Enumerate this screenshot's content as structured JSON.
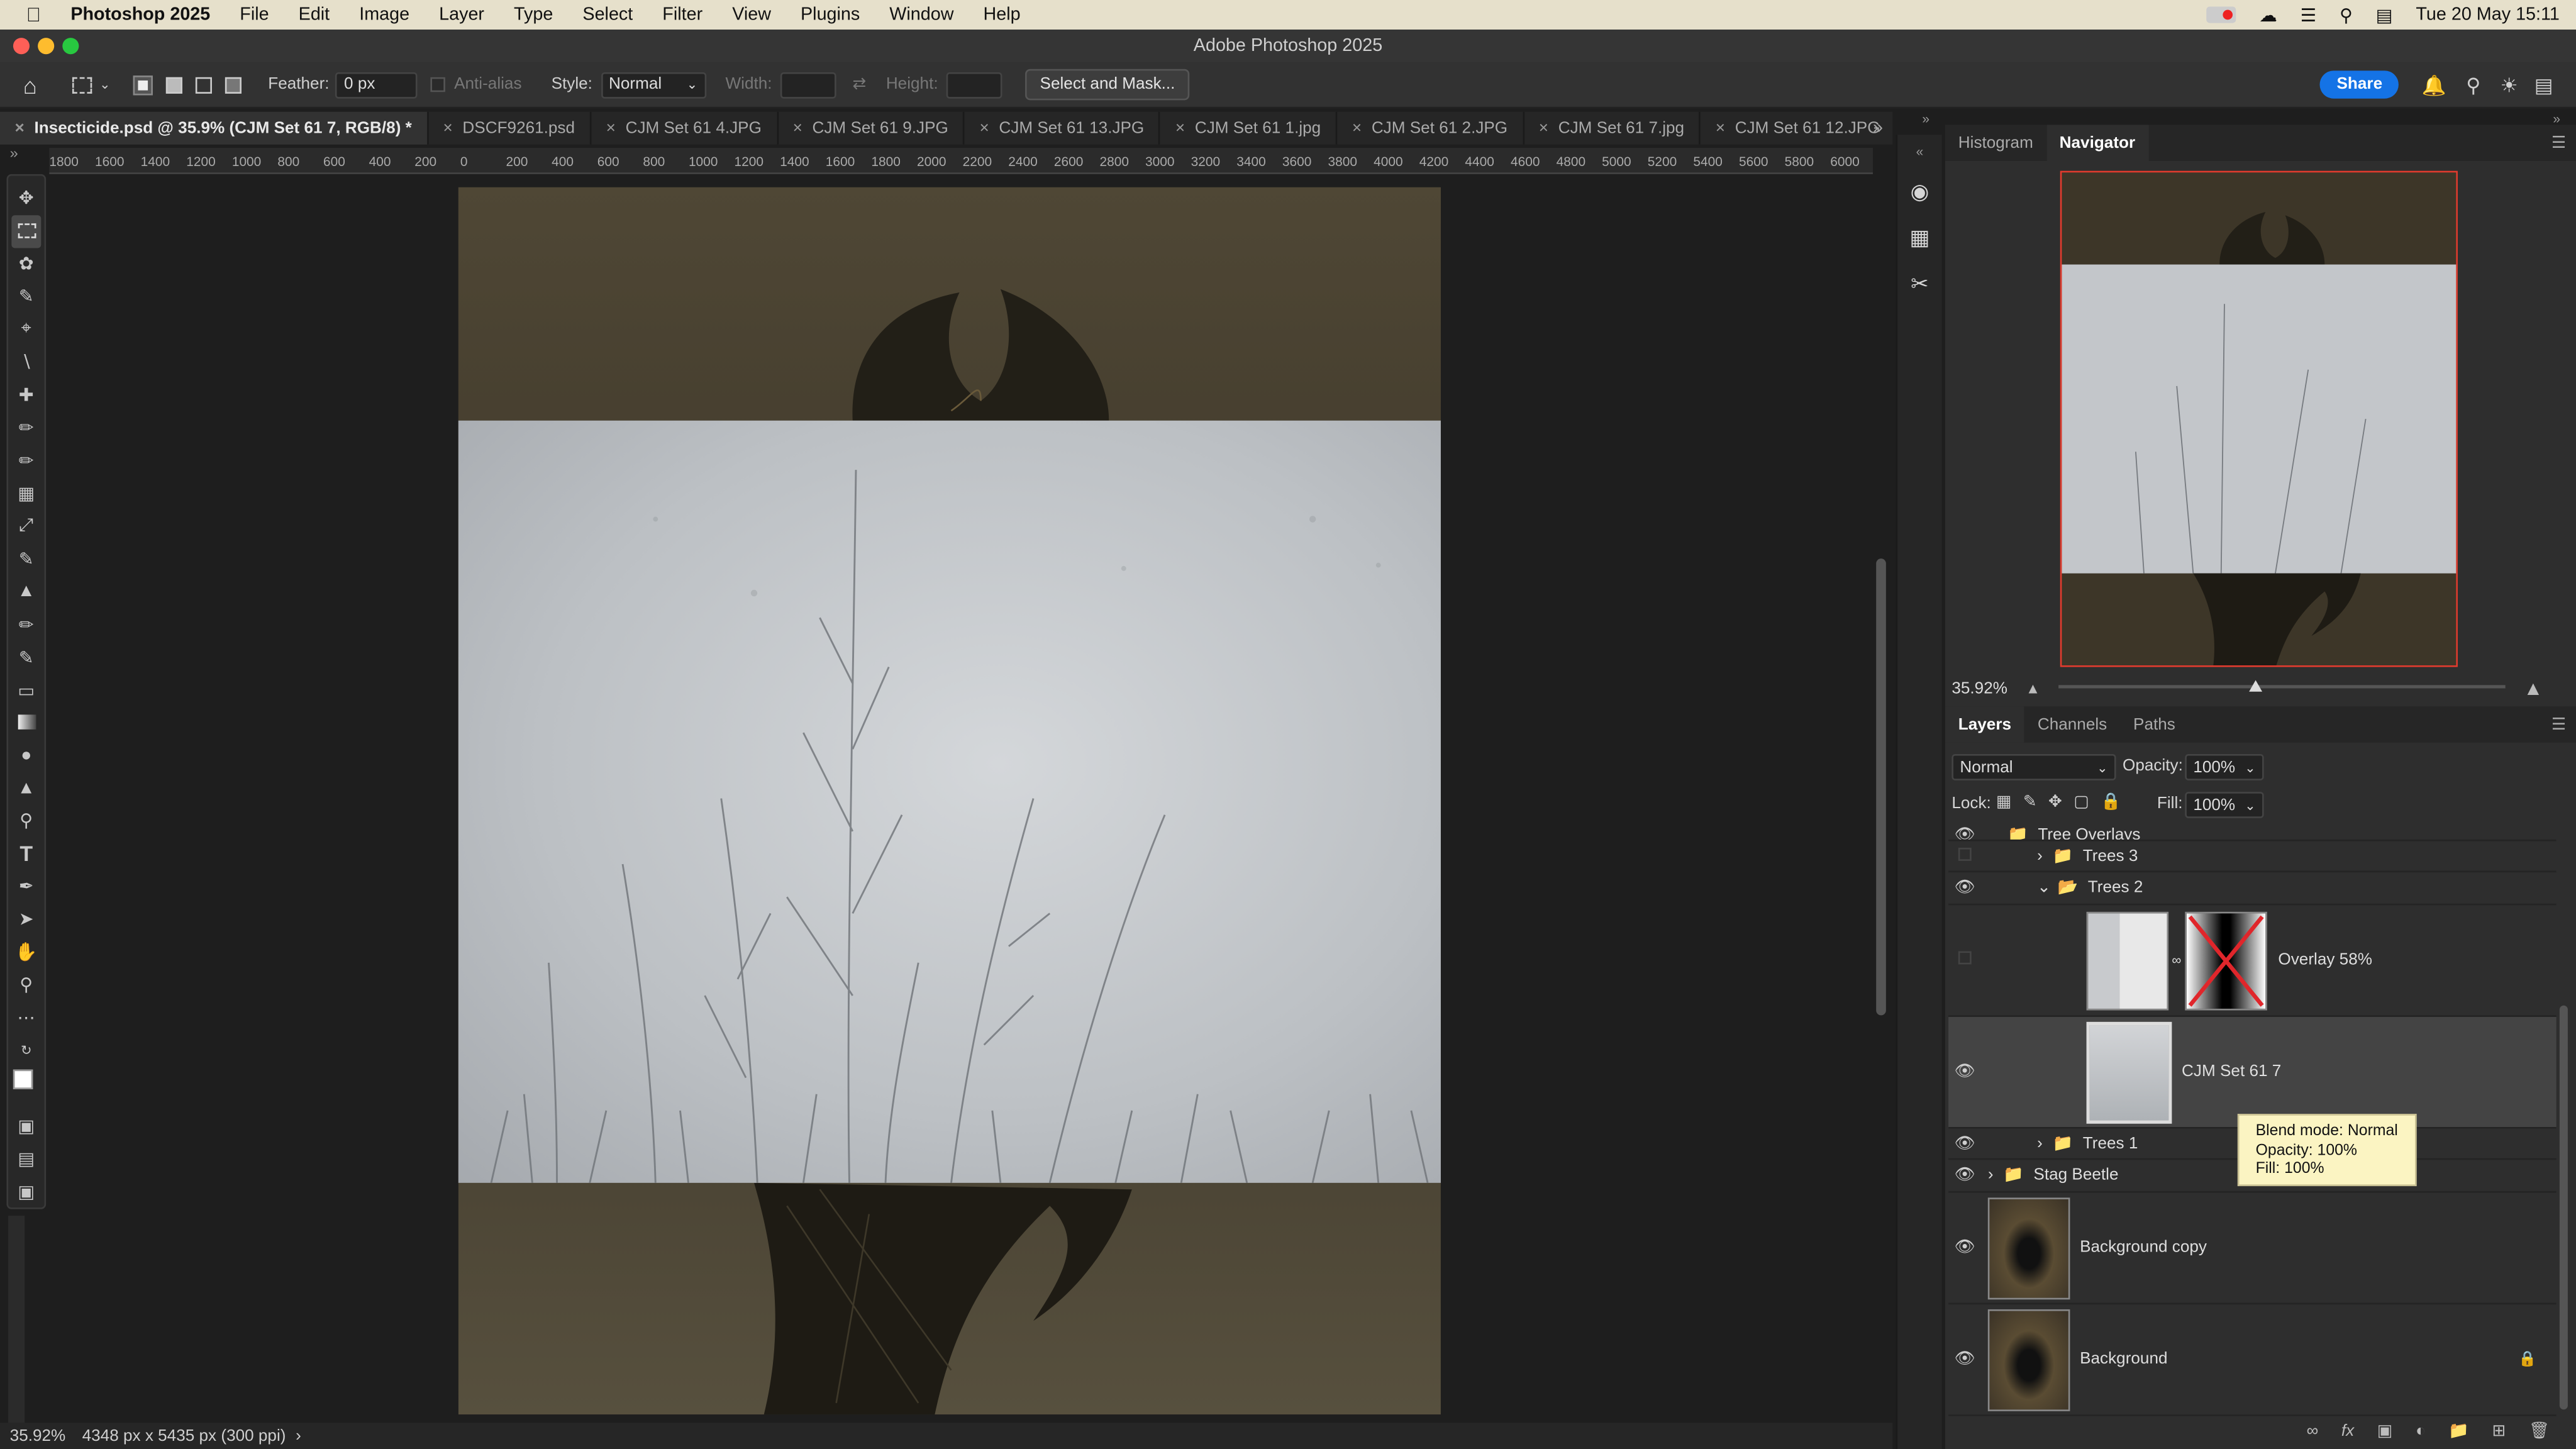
{
  "menubar": {
    "app": "Photoshop 2025",
    "items": [
      "File",
      "Edit",
      "Image",
      "Layer",
      "Type",
      "Select",
      "Filter",
      "View",
      "Plugins",
      "Window",
      "Help"
    ],
    "datetime": "Tue 20 May  15:11"
  },
  "titlebar": {
    "title": "Adobe Photoshop 2025"
  },
  "options": {
    "feather_label": "Feather:",
    "feather_value": "0 px",
    "antialias_label": "Anti-alias",
    "style_label": "Style:",
    "style_value": "Normal",
    "width_label": "Width:",
    "height_label": "Height:",
    "select_mask": "Select and Mask...",
    "share": "Share"
  },
  "tabs": [
    {
      "label": "Insecticide.psd @ 35.9% (CJM Set 61 7, RGB/8) *"
    },
    {
      "label": "DSCF9261.psd"
    },
    {
      "label": "CJM Set 61 4.JPG"
    },
    {
      "label": "CJM Set 61 9.JPG"
    },
    {
      "label": "CJM Set 61 13.JPG"
    },
    {
      "label": "CJM Set 61 1.jpg"
    },
    {
      "label": "CJM Set 61 2.JPG"
    },
    {
      "label": "CJM Set 61 7.jpg"
    },
    {
      "label": "CJM Set 61 12.JPG"
    }
  ],
  "ruler": [
    "1800",
    "1600",
    "1400",
    "1200",
    "1000",
    "800",
    "600",
    "400",
    "200",
    "0",
    "200",
    "400",
    "600",
    "800",
    "1000",
    "1200",
    "1400",
    "1600",
    "1800",
    "2000",
    "2200",
    "2400",
    "2600",
    "2800",
    "3000",
    "3200",
    "3400",
    "3600",
    "3800",
    "4000",
    "4200",
    "4400",
    "4600",
    "4800",
    "5000",
    "5200",
    "5400",
    "5600",
    "5800",
    "6000"
  ],
  "status": {
    "zoom": "35.92%",
    "dims": "4348 px x 5435 px (300 ppi)"
  },
  "navigator": {
    "tabs": [
      "Histogram",
      "Navigator"
    ],
    "zoom": "35.92%",
    "zoom_fraction": 0.44
  },
  "layers_panel": {
    "tabs": [
      "Layers",
      "Channels",
      "Paths"
    ],
    "blend_mode": "Normal",
    "opacity_label": "Opacity:",
    "opacity": "100%",
    "lock_label": "Lock:",
    "fill_label": "Fill:",
    "fill": "100%",
    "rows": {
      "group_partial": "Tree Overlays",
      "trees3": "Trees 3",
      "trees2": "Trees 2",
      "overlay": "Overlay 58%",
      "cjm": "CJM Set 61 7",
      "trees1": "Trees 1",
      "stag": "Stag Beetle",
      "bgcopy": "Background copy",
      "bg": "Background"
    }
  },
  "tooltip": {
    "line1": "Blend mode: Normal",
    "line2": "Opacity: 100%",
    "line3": "Fill: 100%"
  },
  "colors": {
    "accent": "#1473e6",
    "nav_frame": "#e23b2e",
    "tooltip": "#fbf4c2"
  }
}
